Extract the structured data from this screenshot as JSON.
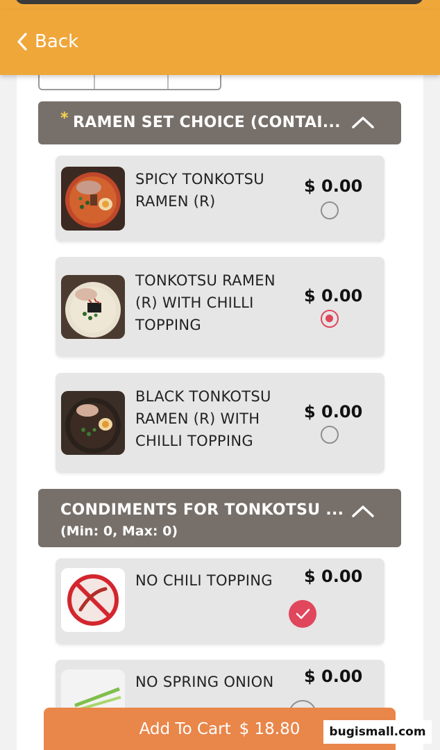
{
  "header": {
    "back_label": "Back"
  },
  "sections": [
    {
      "required_mark": "*",
      "title": "RAMEN SET CHOICE (CONTAI...",
      "items": [
        {
          "name": "SPICY TONKOTSU RAMEN (R)",
          "price": "$ 0.00",
          "selected": false
        },
        {
          "name": "TONKOTSU RAMEN (R) WITH CHILLI TOPPING",
          "price": "$ 0.00",
          "selected": true
        },
        {
          "name": "BLACK TONKOTSU RAMEN (R) WITH CHILLI TOPPING",
          "price": "$ 0.00",
          "selected": false
        }
      ]
    },
    {
      "title": "CONDIMENTS FOR TONKOTSU ...",
      "subtitle": "(Min: 0, Max: 0)",
      "items": [
        {
          "name": "NO CHILI TOPPING",
          "price": "$ 0.00",
          "checked": true,
          "image_text": "NO CHILI TOPPING"
        },
        {
          "name": "NO SPRING ONION",
          "price": "$ 0.00",
          "checked": false,
          "image_text": "NO SPRING"
        }
      ]
    }
  ],
  "cart": {
    "label": "Add To Cart",
    "total": "$ 18.80"
  },
  "watermark": "bugismall.com",
  "colors": {
    "header": "#efa73a",
    "section": "#77706a",
    "accent": "#e0475c",
    "cart": "#e9864a"
  }
}
